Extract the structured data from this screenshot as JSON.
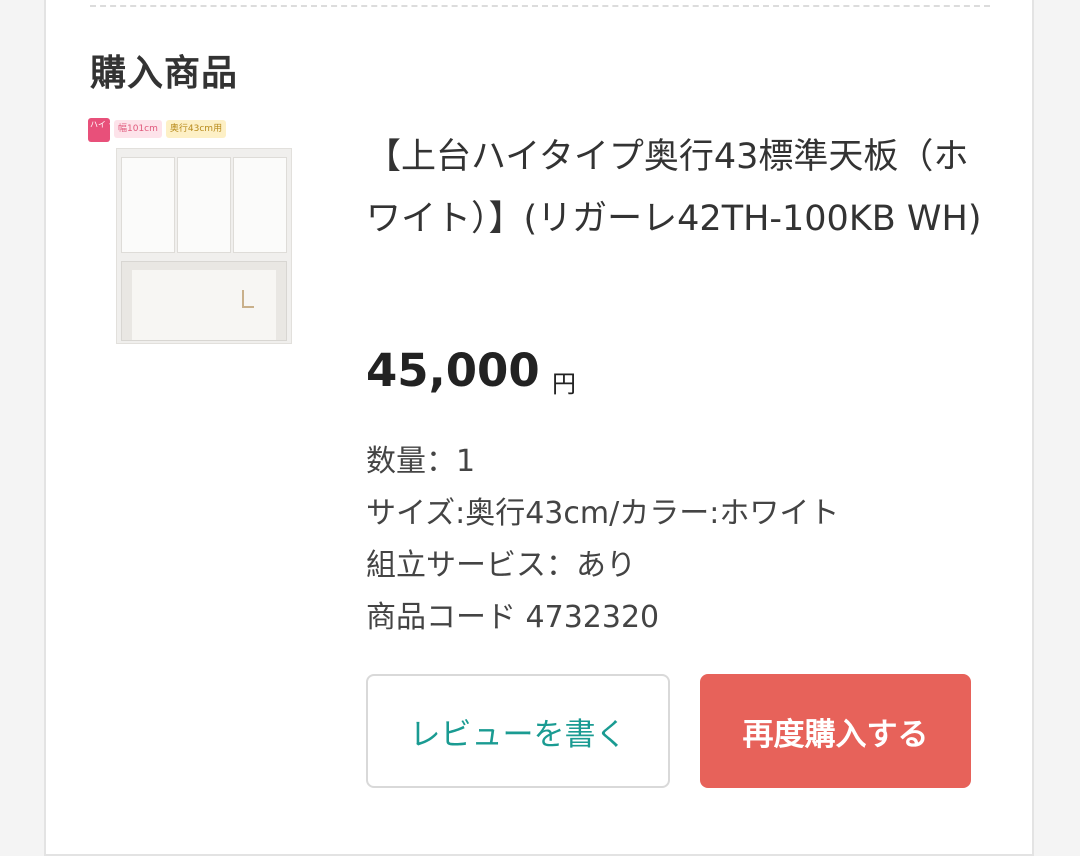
{
  "section": {
    "title": "購入商品"
  },
  "product": {
    "badges": {
      "type": "ハイ タイプ",
      "width": "幅101cm",
      "depth": "奥行43cm用"
    },
    "name": "【上台ハイタイプ奥行43標準天板（ホワイト）】(リガーレ42TH-100KB WH)",
    "price": "45,000",
    "price_unit": "円",
    "quantity": "数量：1",
    "size_color": "サイズ:奥行43cm/カラー:ホワイト",
    "assembly": "組立サービス：あり",
    "code": "商品コード 4732320"
  },
  "actions": {
    "review_label": "レビューを書く",
    "rebuy_label": "再度購入する"
  },
  "colors": {
    "accent": "#e7625a",
    "link": "#1a9b92"
  }
}
